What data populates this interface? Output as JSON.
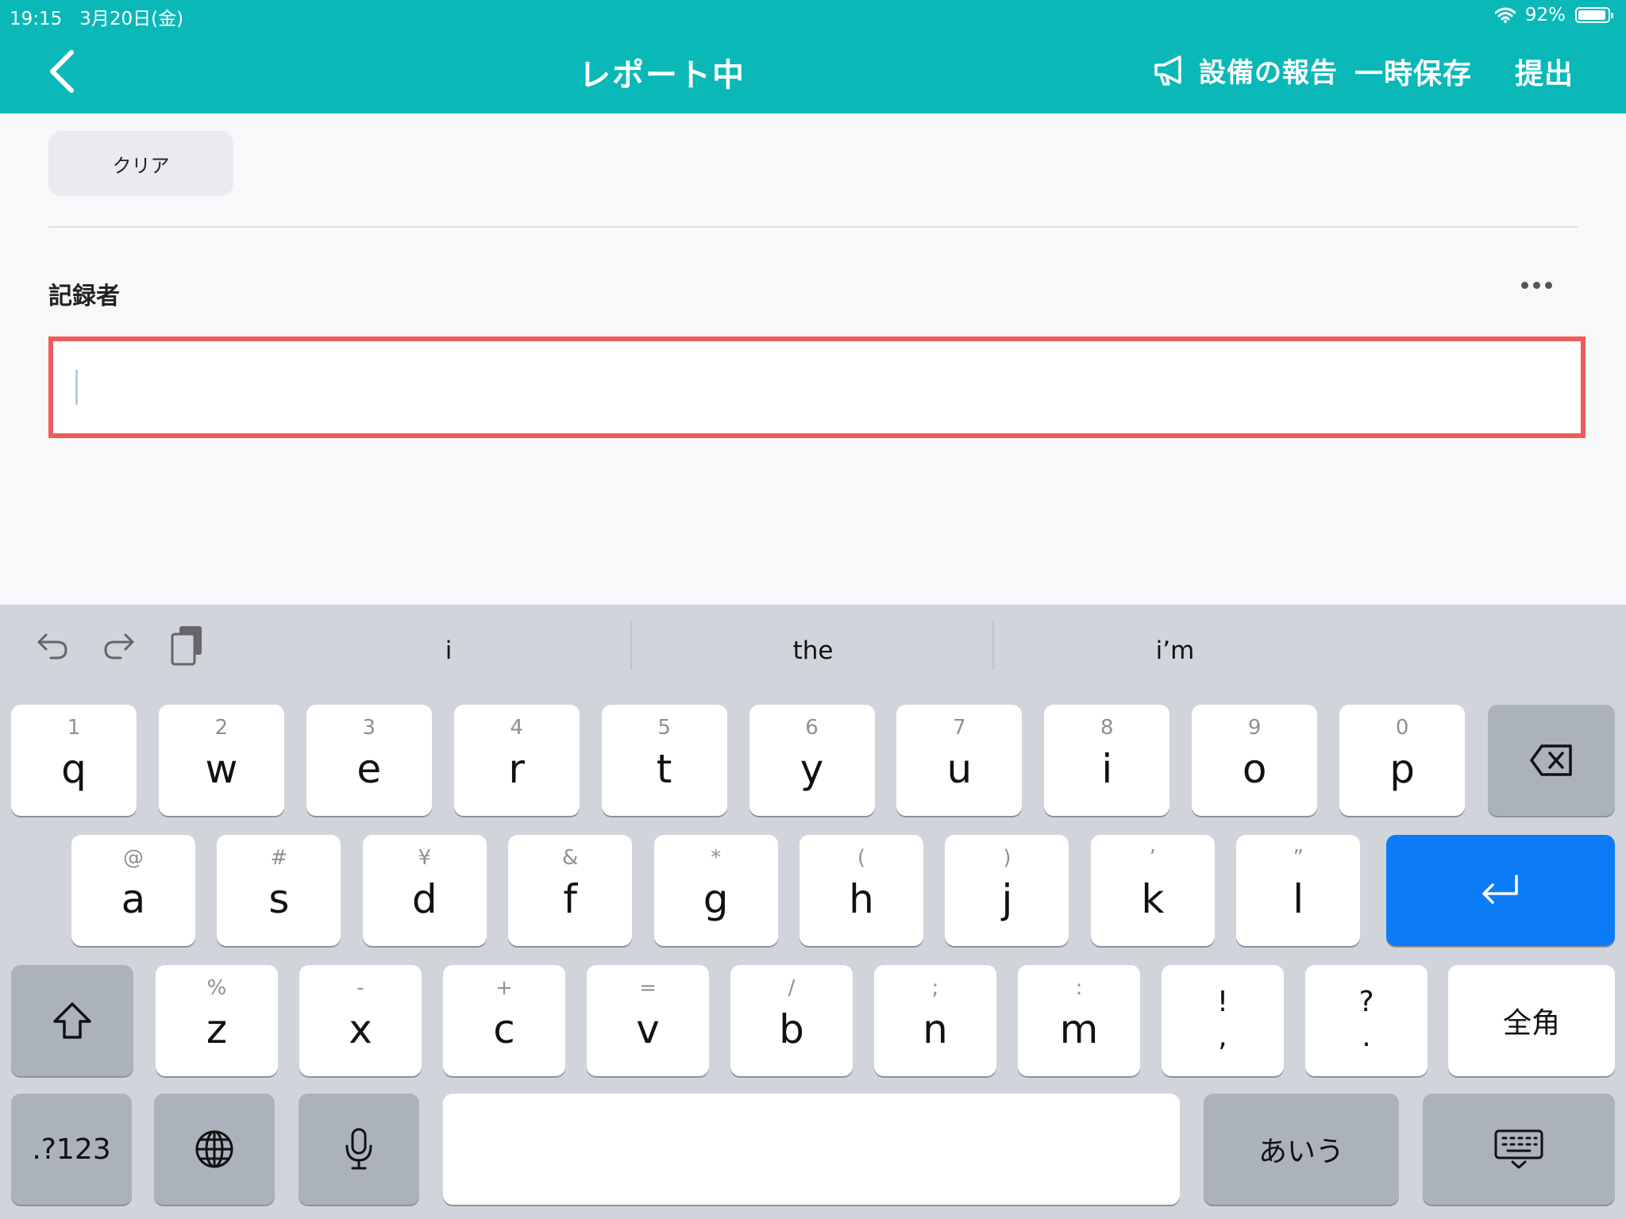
{
  "status": {
    "time": "19:15",
    "date": "3月20日(金)",
    "battery": "92%"
  },
  "nav": {
    "title": "レポート中",
    "report_equipment": "設備の報告",
    "save_draft": "一時保存",
    "submit": "提出"
  },
  "content": {
    "clear_label": "クリア",
    "field_label": "記録者",
    "field_value": ""
  },
  "keyboard": {
    "predictions": [
      "i",
      "the",
      "i’m"
    ],
    "row1": [
      {
        "sub": "1",
        "main": "q"
      },
      {
        "sub": "2",
        "main": "w"
      },
      {
        "sub": "3",
        "main": "e"
      },
      {
        "sub": "4",
        "main": "r"
      },
      {
        "sub": "5",
        "main": "t"
      },
      {
        "sub": "6",
        "main": "y"
      },
      {
        "sub": "7",
        "main": "u"
      },
      {
        "sub": "8",
        "main": "i"
      },
      {
        "sub": "9",
        "main": "o"
      },
      {
        "sub": "0",
        "main": "p"
      }
    ],
    "row2": [
      {
        "sub": "@",
        "main": "a"
      },
      {
        "sub": "#",
        "main": "s"
      },
      {
        "sub": "¥",
        "main": "d"
      },
      {
        "sub": "&",
        "main": "f"
      },
      {
        "sub": "*",
        "main": "g"
      },
      {
        "sub": "(",
        "main": "h"
      },
      {
        "sub": ")",
        "main": "j"
      },
      {
        "sub": "’",
        "main": "k"
      },
      {
        "sub": "”",
        "main": "l"
      }
    ],
    "row3": [
      {
        "sub": "%",
        "main": "z"
      },
      {
        "sub": "-",
        "main": "x"
      },
      {
        "sub": "+",
        "main": "c"
      },
      {
        "sub": "=",
        "main": "v"
      },
      {
        "sub": "/",
        "main": "b"
      },
      {
        "sub": ";",
        "main": "n"
      },
      {
        "sub": ":",
        "main": "m"
      }
    ],
    "punct": [
      {
        "top": "!",
        "bottom": ","
      },
      {
        "top": "?",
        "bottom": "."
      }
    ],
    "fullwidth_label": "全角",
    "numbers_label": ".?123",
    "kana_label": "あいう"
  },
  "icons": [
    "back-chevron-icon",
    "megaphone-icon",
    "wifi-icon",
    "battery-icon",
    "undo-icon",
    "redo-icon",
    "clipboard-icon",
    "delete-icon",
    "return-icon",
    "shift-icon",
    "globe-icon",
    "microphone-icon",
    "keyboard-dismiss-icon"
  ]
}
